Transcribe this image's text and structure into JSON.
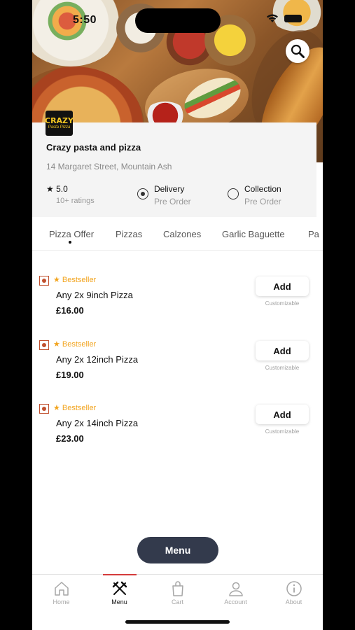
{
  "status_bar": {
    "time": "5:50"
  },
  "restaurant": {
    "logo_text": "CRAZY",
    "logo_sub": "Pasta Pizza",
    "name": "Crazy pasta and pizza",
    "address": "14 Margaret Street, Mountain Ash",
    "rating": "5.0",
    "ratings_count": "10+ ratings"
  },
  "order_options": [
    {
      "label": "Delivery",
      "sub": "Pre Order",
      "selected": true
    },
    {
      "label": "Collection",
      "sub": "Pre Order",
      "selected": false
    }
  ],
  "tabs": [
    {
      "label": "Pizza Offer",
      "active": true
    },
    {
      "label": "Pizzas",
      "active": false
    },
    {
      "label": "Calzones",
      "active": false
    },
    {
      "label": "Garlic Baguette",
      "active": false
    },
    {
      "label": "Pa",
      "active": false
    }
  ],
  "items": [
    {
      "badge": "Bestseller",
      "name": "Any 2x 9inch Pizza",
      "price": "£16.00",
      "add_label": "Add",
      "note": "Customizable"
    },
    {
      "badge": "Bestseller",
      "name": "Any 2x 12inch Pizza",
      "price": "£19.00",
      "add_label": "Add",
      "note": "Customizable"
    },
    {
      "badge": "Bestseller",
      "name": "Any 2x 14inch Pizza",
      "price": "£23.00",
      "add_label": "Add",
      "note": "Customizable"
    }
  ],
  "menu_button": "Menu",
  "bottom_nav": [
    {
      "label": "Home",
      "icon": "home-icon",
      "active": false
    },
    {
      "label": "Menu",
      "icon": "fork-knife-icon",
      "active": true
    },
    {
      "label": "Cart",
      "icon": "bag-icon",
      "active": false
    },
    {
      "label": "Account",
      "icon": "person-icon",
      "active": false
    },
    {
      "label": "About",
      "icon": "info-icon",
      "active": false
    }
  ],
  "colors": {
    "accent_red": "#d53b3b",
    "bestseller": "#f2a41e",
    "menu_pill": "#333a4c"
  }
}
